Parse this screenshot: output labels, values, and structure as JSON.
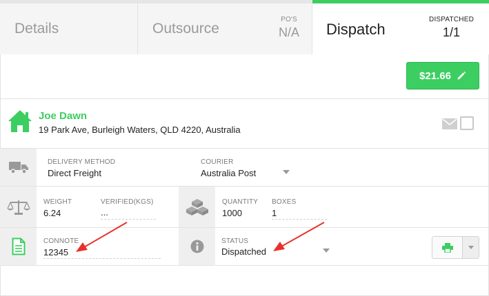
{
  "tabs": {
    "details": {
      "label": "Details"
    },
    "outsource": {
      "label": "Outsource",
      "meta_label": "PO'S",
      "meta_value": "N/A"
    },
    "dispatch": {
      "label": "Dispatch",
      "meta_label": "DISPATCHED",
      "meta_value": "1/1"
    }
  },
  "price": {
    "label": "$21.66"
  },
  "address": {
    "name": "Joe Dawn",
    "line": "19 Park Ave, Burleigh Waters, QLD 4220, Australia"
  },
  "delivery": {
    "method_label": "DELIVERY METHOD",
    "method_value": "Direct Freight",
    "courier_label": "COURIER",
    "courier_value": "Australia Post"
  },
  "weight": {
    "weight_label": "WEIGHT",
    "weight_value": "6.24",
    "verified_label": "VERIFIED(KGS)",
    "verified_value": "..."
  },
  "quantity": {
    "quantity_label": "QUANTITY",
    "quantity_value": "1000",
    "boxes_label": "BOXES",
    "boxes_value": "1"
  },
  "connote": {
    "label": "CONNOTE",
    "value": "12345"
  },
  "status": {
    "label": "STATUS",
    "value": "Dispatched"
  },
  "colors": {
    "accent_green": "#3cce61",
    "arrow_red": "#e8302a",
    "icon_gray": "#999999"
  },
  "icons": [
    "pencil-icon",
    "home-icon",
    "mail-icon",
    "truck-icon",
    "scale-icon",
    "boxes-icon",
    "document-icon",
    "info-icon",
    "print-icon",
    "chevron-down-icon"
  ]
}
